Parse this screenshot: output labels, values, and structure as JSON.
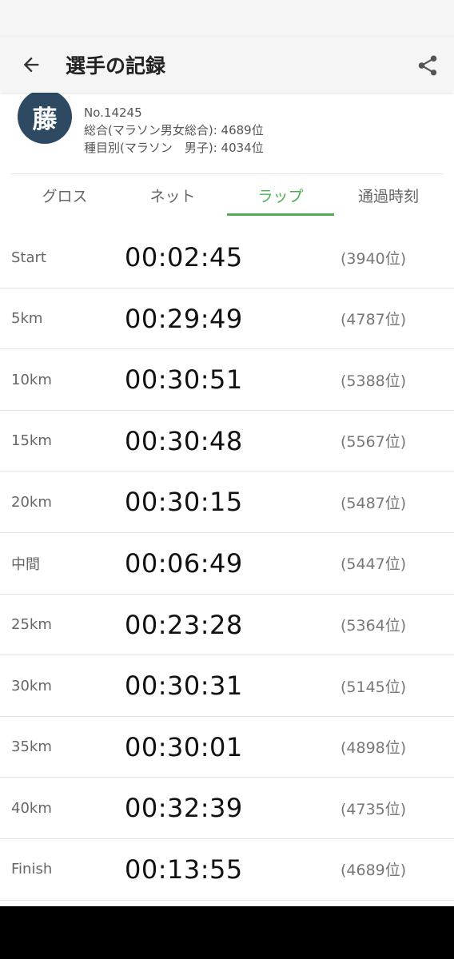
{
  "header": {
    "title": "選手の記録",
    "back_icon": "arrow-left-icon",
    "share_icon": "share-icon"
  },
  "profile": {
    "avatar_char": "藤",
    "avatar_color": "#2e4a63",
    "number": "No.14245",
    "overall_rank": "総合(マラソン男女総合): 4689位",
    "category_rank": "種目別(マラソン　男子): 4034位"
  },
  "tabs": [
    {
      "label": "グロス",
      "active": false
    },
    {
      "label": "ネット",
      "active": false
    },
    {
      "label": "ラップ",
      "active": true
    },
    {
      "label": "通過時刻",
      "active": false
    }
  ],
  "accent_color": "#4caf50",
  "laps": [
    {
      "label": "Start",
      "time": "00:02:45",
      "rank": "(3940位)"
    },
    {
      "label": "5km",
      "time": "00:29:49",
      "rank": "(4787位)"
    },
    {
      "label": "10km",
      "time": "00:30:51",
      "rank": "(5388位)"
    },
    {
      "label": "15km",
      "time": "00:30:48",
      "rank": "(5567位)"
    },
    {
      "label": "20km",
      "time": "00:30:15",
      "rank": "(5487位)"
    },
    {
      "label": "中間",
      "time": "00:06:49",
      "rank": "(5447位)"
    },
    {
      "label": "25km",
      "time": "00:23:28",
      "rank": "(5364位)"
    },
    {
      "label": "30km",
      "time": "00:30:31",
      "rank": "(5145位)"
    },
    {
      "label": "35km",
      "time": "00:30:01",
      "rank": "(4898位)"
    },
    {
      "label": "40km",
      "time": "00:32:39",
      "rank": "(4735位)"
    },
    {
      "label": "Finish",
      "time": "00:13:55",
      "rank": "(4689位)"
    }
  ]
}
